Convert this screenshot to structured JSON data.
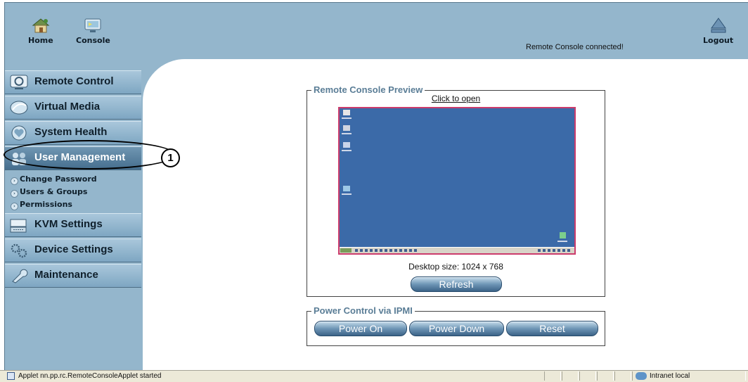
{
  "header": {
    "home_label": "Home",
    "console_label": "Console",
    "logout_label": "Logout",
    "status_message": "Remote Console connected!"
  },
  "sidebar": {
    "items": [
      {
        "label": "Remote Control",
        "icon": "monitor-icon"
      },
      {
        "label": "Virtual Media",
        "icon": "disc-icon"
      },
      {
        "label": "System Health",
        "icon": "heart-icon"
      },
      {
        "label": "User Management",
        "icon": "users-icon",
        "active": true
      },
      {
        "label": "KVM Settings",
        "icon": "keyboard-icon"
      },
      {
        "label": "Device Settings",
        "icon": "gears-icon"
      },
      {
        "label": "Maintenance",
        "icon": "wrench-icon"
      }
    ],
    "submenu": [
      {
        "label": "Change Password"
      },
      {
        "label": "Users & Groups"
      },
      {
        "label": "Permissions"
      }
    ]
  },
  "preview": {
    "legend": "Remote Console Preview",
    "open_link": "Click to open",
    "desktop_size": "Desktop size: 1024 x 768",
    "refresh_label": "Refresh"
  },
  "power": {
    "legend": "Power Control via IPMI",
    "power_on_label": "Power On",
    "power_down_label": "Power Down",
    "reset_label": "Reset"
  },
  "annotation": {
    "number": "1"
  },
  "statusbar": {
    "message": "Applet nn.pp.rc.RemoteConsoleApplet started",
    "zone": "Intranet local"
  },
  "colors": {
    "frame_bg": "#94b6cc",
    "desktop_bg": "#3b6aa8",
    "preview_border": "#cc3c6c",
    "legend_text": "#5a7d96"
  }
}
